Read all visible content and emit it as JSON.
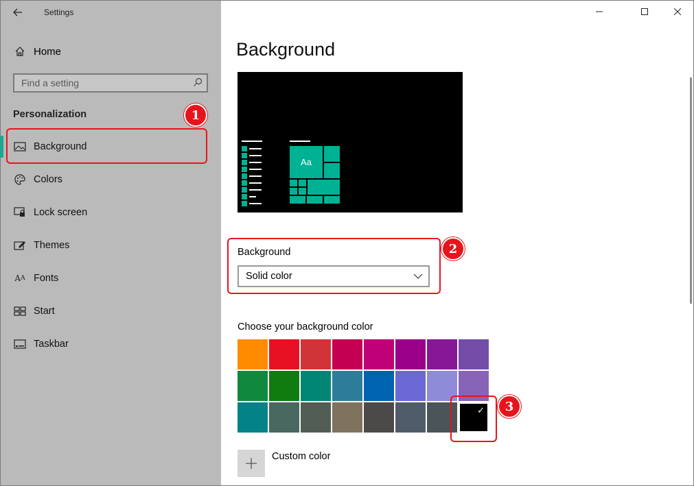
{
  "window": {
    "title": "Settings",
    "controls": {
      "minimize": "minimize",
      "maximize": "maximize",
      "close": "close"
    }
  },
  "sidebar": {
    "home_label": "Home",
    "search_placeholder": "Find a setting",
    "section_title": "Personalization",
    "items": [
      {
        "label": "Background",
        "icon": "picture-icon",
        "active": true
      },
      {
        "label": "Colors",
        "icon": "palette-icon",
        "active": false
      },
      {
        "label": "Lock screen",
        "icon": "lock-screen-icon",
        "active": false
      },
      {
        "label": "Themes",
        "icon": "brush-icon",
        "active": false
      },
      {
        "label": "Fonts",
        "icon": "font-icon",
        "active": false
      },
      {
        "label": "Start",
        "icon": "start-icon",
        "active": false
      },
      {
        "label": "Taskbar",
        "icon": "taskbar-icon",
        "active": false
      }
    ],
    "accent_color": "#00b294"
  },
  "main": {
    "title": "Background",
    "preview": {
      "tile_label": "Aa",
      "accent": "#00b294"
    },
    "background_label": "Background",
    "background_value": "Solid color",
    "color_section_label": "Choose your background color",
    "colors": [
      [
        "#ff8c00",
        "#e81123",
        "#d13438",
        "#c30052",
        "#bf0077",
        "#9a0089",
        "#881798",
        "#744da9"
      ],
      [
        "#10893e",
        "#107c10",
        "#018574",
        "#2d7d9a",
        "#0063b1",
        "#6b69d6",
        "#8e8cd8",
        "#8764b8"
      ],
      [
        "#038387",
        "#486860",
        "#525e54",
        "#7e735f",
        "#4c4a48",
        "#515c6b",
        "#4a5459",
        "#000000"
      ]
    ],
    "selected_color": "#000000",
    "custom_color_label": "Custom color",
    "custom_icon": "plus-icon"
  },
  "annotations": [
    {
      "number": "1",
      "color": "#e8141b"
    },
    {
      "number": "2",
      "color": "#e8141b"
    },
    {
      "number": "3",
      "color": "#e8141b"
    }
  ]
}
